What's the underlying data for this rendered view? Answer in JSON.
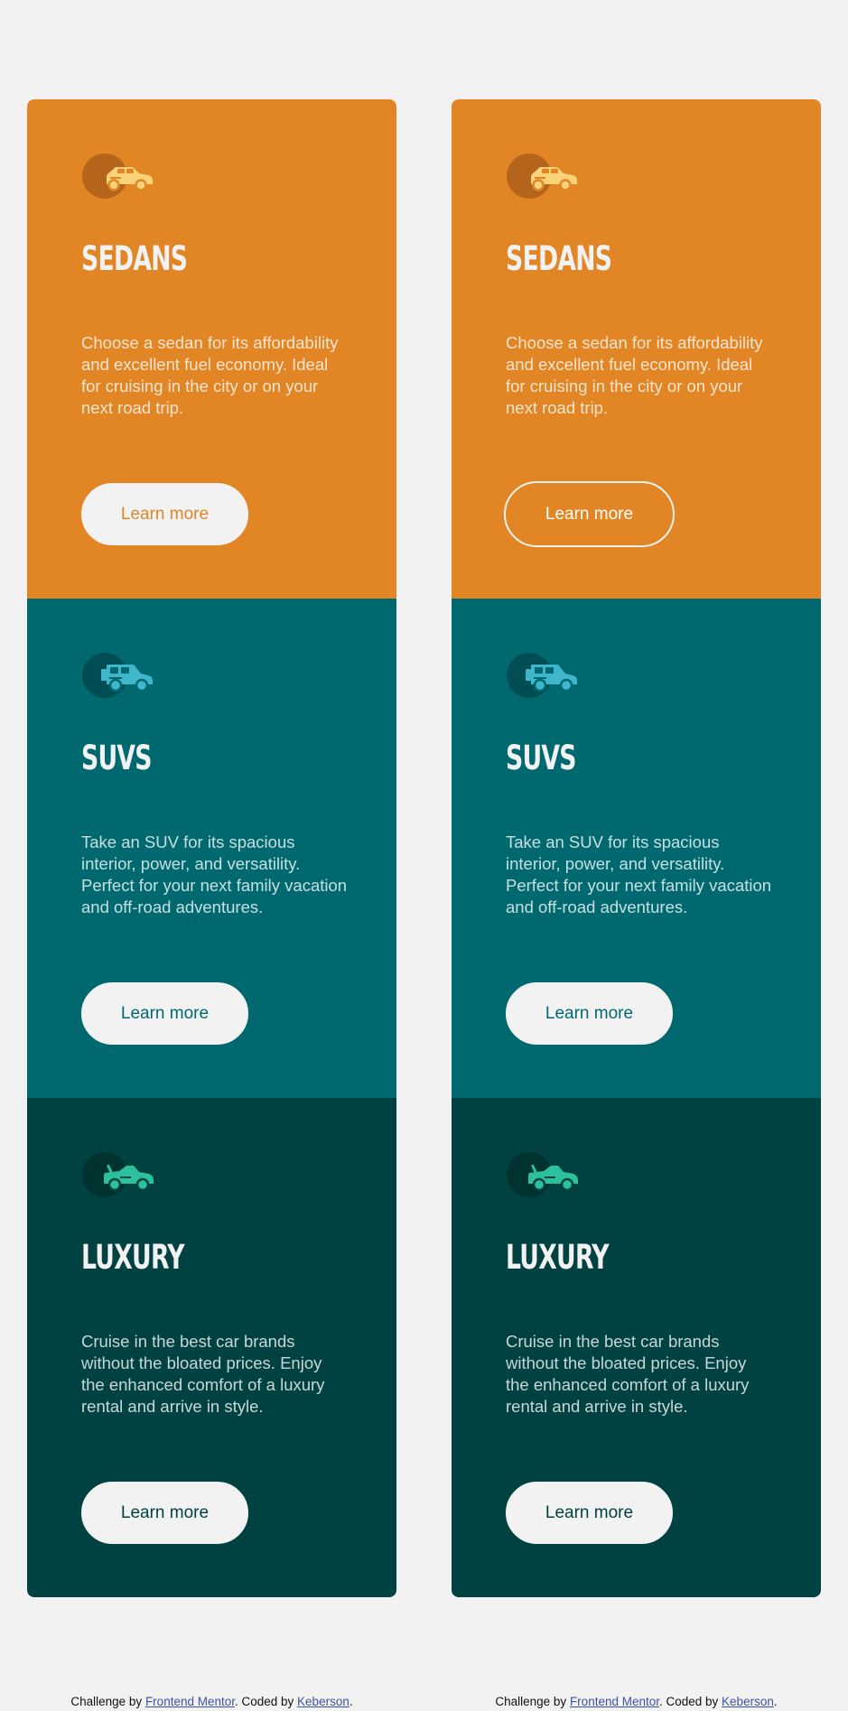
{
  "colors": {
    "page_background": "#f2f2f2",
    "sedan": "#e28625",
    "suv": "#006970",
    "luxury": "#004241",
    "button_background": "#f2f2f2"
  },
  "cards": [
    {
      "title": "SEDANS",
      "icon": "sedan-car-icon",
      "text": "Choose a sedan for its affordability and excellent fuel economy. Ideal for cruising in the city or on your next road trip.",
      "button_label": "Learn more"
    },
    {
      "title": "SUVS",
      "icon": "suv-car-icon",
      "text": "Take an SUV for its spacious interior, power, and versatility. Perfect for your next family vacation and off-road adventures.",
      "button_label": "Learn more"
    },
    {
      "title": "LUXURY",
      "icon": "luxury-car-icon",
      "text": "Cruise in the best car brands without the bloated prices. Enjoy the enhanced comfort of a luxury rental and arrive in style.",
      "button_label": "Learn more"
    }
  ],
  "hover_preview_state": {
    "column": "right",
    "card": "SEDANS",
    "button_style": "outlined"
  },
  "attribution": {
    "prefix": "Challenge by ",
    "challenge_link": "Frontend Mentor",
    "middle": ". Coded by ",
    "author_link": "Keberson",
    "suffix": "."
  }
}
